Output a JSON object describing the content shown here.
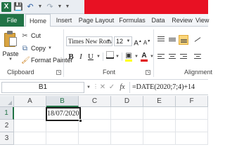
{
  "quick_access": {
    "app_icon": "X",
    "icons": [
      "excel-logo",
      "save-icon",
      "undo-icon",
      "redo-icon",
      "customize-icon"
    ]
  },
  "tabs": {
    "file": "File",
    "home": "Home",
    "insert": "Insert",
    "page_layout": "Page Layout",
    "formulas": "Formulas",
    "data": "Data",
    "review": "Review",
    "view": "View",
    "active": "Home"
  },
  "ribbon": {
    "clipboard": {
      "paste": "Paste",
      "cut": "Cut",
      "copy": "Copy",
      "format_painter": "Format Painter",
      "group_label": "Clipboard"
    },
    "font": {
      "font_name": "Times New Roman",
      "font_size": "12",
      "bold": "B",
      "italic": "I",
      "underline": "U",
      "font_color_letter": "A",
      "group_label": "Font",
      "fill_color": "#ffff00",
      "font_color": "#e00000"
    },
    "alignment": {
      "group_label": "Alignment"
    }
  },
  "formula_bar": {
    "name_box": "B1",
    "fx": "fx",
    "formula": "=DATE(2020;7;4)+14"
  },
  "grid": {
    "columns": [
      "A",
      "B",
      "C",
      "D",
      "E",
      "F"
    ],
    "rows": [
      "1",
      "2",
      "3"
    ],
    "selected_cell": "B1",
    "selected_value": "18/07/2020"
  },
  "colors": {
    "accent": "#217346",
    "title_accent": "#e81123"
  }
}
